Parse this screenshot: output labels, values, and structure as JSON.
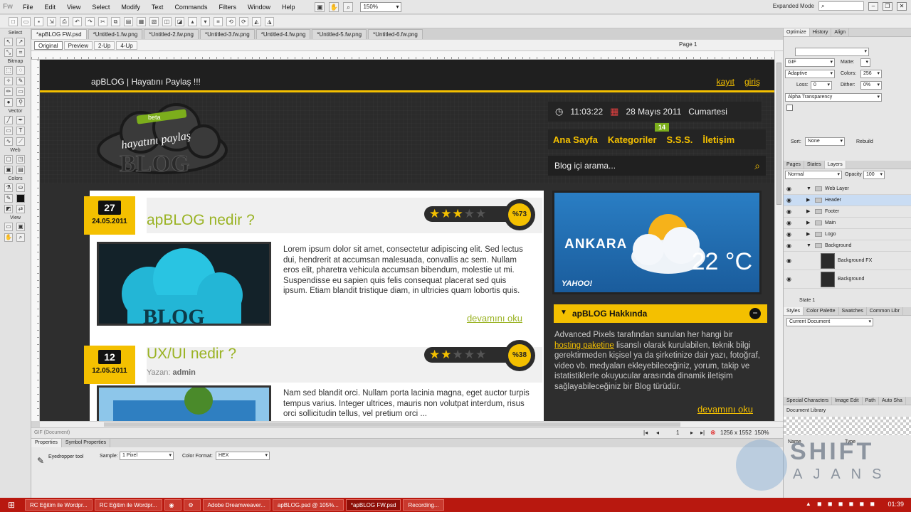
{
  "app": {
    "menu": [
      "File",
      "Edit",
      "View",
      "Select",
      "Modify",
      "Text",
      "Commands",
      "Filters",
      "Window",
      "Help"
    ],
    "zoom": "150%",
    "mode": "Expanded Mode"
  },
  "doc_tabs": [
    "*apBLOG FW.psd",
    "*Untitled-1.fw.png",
    "*Untitled-2.fw.png",
    "*Untitled-3.fw.png",
    "*Untitled-4.fw.png",
    "*Untitled-5.fw.png",
    "*Untitled-6.fw.png"
  ],
  "view_buttons": [
    "Original",
    "Preview",
    "2-Up",
    "4-Up"
  ],
  "page_label": "Page 1",
  "tools_sections": [
    "Select",
    "Bitmap",
    "Vector",
    "Web",
    "Colors",
    "View"
  ],
  "site": {
    "brand": "apBLOG | Hayatını Paylaş !!!",
    "top_links": [
      "kayıt",
      "giriş"
    ],
    "time": "11:03:22",
    "date": "28 Mayıs 2011",
    "weekday": "Cumartesi",
    "nav": [
      "Ana Sayfa",
      "Kategoriler",
      "S.S.S.",
      "İletişim"
    ],
    "nav_badge": "14",
    "search_placeholder": "Blog içi arama...",
    "logo_top": "hayatını paylaş",
    "logo_tag": "beta",
    "logo_word": "BLOG",
    "posts": [
      {
        "day": "27",
        "date": "24.05.2011",
        "title": "apBLOG nedir ?",
        "rating_percent": "%73",
        "stars": 3,
        "thumb_text": "BLOG",
        "excerpt": "Lorem ipsum dolor sit amet, consectetur adipiscing elit. Sed lectus dui, hendrerit at accumsan malesuada, convallis ac sem. Nullam eros elit, pharetra vehicula accumsan bibendum, molestie ut mi. Suspendisse eu sapien quis felis consequat placerat sed quis ipsum. Etiam blandit tristique diam, in ultricies quam lobortis quis.",
        "read_more": "devamını oku"
      },
      {
        "day": "12",
        "date": "12.05.2011",
        "title": "UX/UI nedir ?",
        "author_label": "Yazan:",
        "author": "admin",
        "rating_percent": "%38",
        "stars": 2,
        "excerpt": "Nam sed blandit orci. Nullam porta lacinia magna, eget auctor turpis tempus varius. Integer ultrices, mauris non volutpat interdum, risus orci sollicitudin tellus, vel pretium orci ..."
      }
    ],
    "weather": {
      "city": "ANKARA",
      "temp": "22 °C",
      "provider": "YAHOO!"
    },
    "about_title": "apBLOG Hakkında",
    "about_pre": "Advanced Pixels tarafından sunulan her hangi bir ",
    "about_link": "hosting paketine",
    "about_post": " lisanslı olarak kurulabilen, teknik bilgi gerektirmeden kişisel ya da şirketinize dair yazı, fotoğraf, video vb. medyaları ekleyebileceğiniz, yorum, takip ve istatistiklerle okuyucular arasında dinamik iletişim sağlayabileceğiniz bir Blog türüdür.",
    "about_more": "devamını oku"
  },
  "status": {
    "doc_size": "1256 x 1552",
    "zoom": "150%",
    "page": "1",
    "doc_type": "GIF (Document)"
  },
  "properties": {
    "tabs": [
      "Properties",
      "Symbol Properties"
    ],
    "tool": "Eyedropper tool",
    "sample_label": "Sample:",
    "sample": "1 Pixel",
    "format_label": "Color Format:",
    "format": "HEX"
  },
  "optimize": {
    "tabs": [
      "Optimize",
      "History",
      "Align"
    ],
    "format": "GIF",
    "matte_label": "Matte:",
    "palette": "Adaptive",
    "colors_label": "Colors:",
    "colors": "256",
    "loss_label": "Loss:",
    "loss": "0",
    "dither_label": "Dither:",
    "dither": "0%",
    "transparency": "Alpha Transparency",
    "sort_label": "Sort:",
    "sort": "None",
    "rebuild": "Rebuild"
  },
  "layers": {
    "tabs": [
      "Pages",
      "States",
      "Layers"
    ],
    "blend": "Normal",
    "opacity_label": "Opacity",
    "opacity": "100",
    "items": [
      "Web Layer",
      "Header",
      "Footer",
      "Main",
      "Logo",
      "Background",
      "Background FX",
      "Background"
    ],
    "state": "State 1"
  },
  "styles": {
    "tabs": [
      "Styles",
      "Color Palette",
      "Swatches",
      "Common Libr"
    ],
    "current": "Current Document",
    "lib_tabs": [
      "Special Characters",
      "Image Edit",
      "Path",
      "Auto Sha"
    ],
    "doc_lib": "Document Library",
    "col_name": "Name",
    "col_type": "Type"
  },
  "watermark": {
    "line1": "SHIFT",
    "line2": "AJANS"
  },
  "taskbar": {
    "tasks": [
      "RC Eğitim ile Wordpr...",
      "RC Eğitim ile Wordpr...",
      "",
      "",
      "Adobe Dreamweaver...",
      "apBLOG.psd @ 105%...",
      "*apBLOG FW.psd",
      "Recording..."
    ],
    "clock": "01:39"
  },
  "colors": {
    "accent": "#f4c000",
    "green": "#9ab324",
    "taskbar": "#b8180f"
  }
}
